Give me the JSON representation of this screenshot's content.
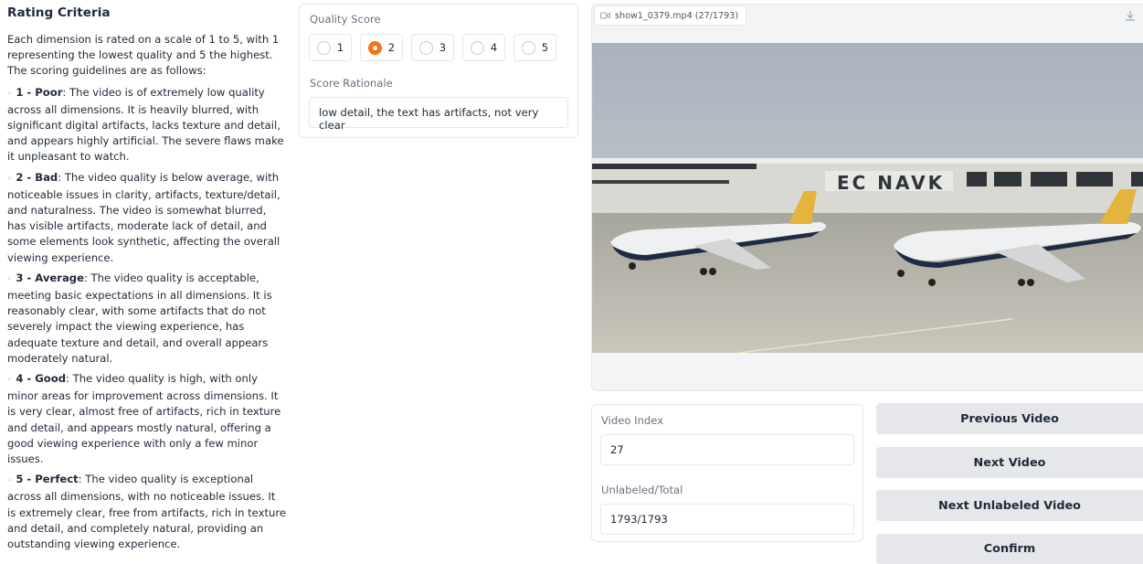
{
  "criteria": {
    "title": "Rating Criteria",
    "intro": "Each dimension is rated on a scale of 1 to 5, with 1 representing the lowest quality and 5 the highest. The scoring guidelines are as follows:",
    "items": [
      {
        "bullet": "◦",
        "heading": "1 - Poor",
        "text": ": The video is of extremely low quality across all dimensions. It is heavily blurred, with significant digital artifacts, lacks texture and detail, and appears highly artificial. The severe flaws make it unpleasant to watch."
      },
      {
        "bullet": "◦",
        "heading": "2 - Bad",
        "text": ": The video quality is below average, with noticeable issues in clarity, artifacts, texture/detail, and naturalness. The video is somewhat blurred, has visible artifacts, moderate lack of detail, and some elements look synthetic, affecting the overall viewing experience."
      },
      {
        "bullet": "◦",
        "heading": "3 - Average",
        "text": ": The video quality is acceptable, meeting basic expectations in all dimensions. It is reasonably clear, with some artifacts that do not severely impact the viewing experience, has adequate texture and detail, and overall appears moderately natural."
      },
      {
        "bullet": "◦",
        "heading": "4 - Good",
        "text": ": The video quality is high, with only minor areas for improvement across dimensions. It is very clear, almost free of artifacts, rich in texture and detail, and appears mostly natural, offering a good viewing experience with only a few minor issues."
      },
      {
        "bullet": "◦",
        "heading": "5 - Perfect",
        "text": ": The video quality is exceptional across all dimensions, with no noticeable issues. It is extremely clear, free from artifacts, rich in texture and detail, and completely natural, providing an outstanding viewing experience."
      }
    ]
  },
  "score": {
    "label": "Quality Score",
    "options": [
      "1",
      "2",
      "3",
      "4",
      "5"
    ],
    "selected": "2",
    "rationale_label": "Score Rationale",
    "rationale_value": "low detail, the text has artifacts, not very clear"
  },
  "video": {
    "tab_label": "show1_0379.mp4 (27/1793)",
    "icons": {
      "tab": "video-camera-icon",
      "download": "download-icon"
    },
    "frame_text": "EC NAVK"
  },
  "index": {
    "index_label": "Video Index",
    "index_value": "27",
    "count_label": "Unlabeled/Total",
    "count_value": "1793/1793"
  },
  "buttons": {
    "previous": "Previous Video",
    "next": "Next Video",
    "next_unlabeled": "Next Unlabeled Video",
    "confirm": "Confirm"
  },
  "colors": {
    "accent": "#f97316",
    "button_bg": "#e5e7eb",
    "border": "#e5e7eb"
  }
}
